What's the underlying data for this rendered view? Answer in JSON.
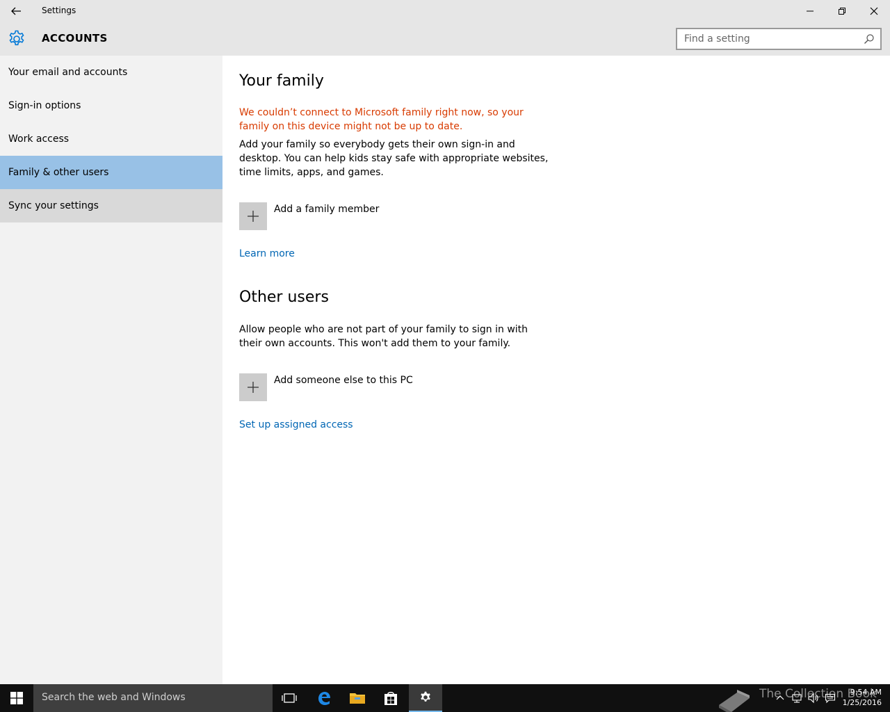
{
  "window": {
    "title": "Settings"
  },
  "header": {
    "section_title": "ACCOUNTS",
    "search_placeholder": "Find a setting"
  },
  "sidebar": {
    "items": [
      {
        "label": "Your email and accounts"
      },
      {
        "label": "Sign-in options"
      },
      {
        "label": "Work access"
      },
      {
        "label": "Family & other users",
        "selected": true
      },
      {
        "label": "Sync your settings"
      }
    ]
  },
  "family": {
    "heading": "Your family",
    "warning": "We couldn’t connect to Microsoft family right now, so your family on this device might not be up to date.",
    "description": "Add your family so everybody gets their own sign-in and desktop. You can help kids stay safe with appropriate websites, time limits, apps, and games.",
    "add_label": "Add a family member",
    "learn_more": "Learn more"
  },
  "other_users": {
    "heading": "Other users",
    "description": "Allow people who are not part of your family to sign in with their own accounts. This won't add them to your family.",
    "add_label": "Add someone else to this PC",
    "assigned_access": "Set up assigned access"
  },
  "taskbar": {
    "search_placeholder": "Search the web and Windows",
    "apps": [
      "task-view-icon",
      "edge-icon",
      "file-explorer-icon",
      "store-icon",
      "settings-icon"
    ],
    "watermark": "The Collection Book",
    "time": "9:54 AM",
    "date": "1/25/2016"
  },
  "colors": {
    "accent": "#0078d7",
    "selected_item": "#98c1e6",
    "warning": "#d83b01",
    "link": "#0066b4"
  }
}
